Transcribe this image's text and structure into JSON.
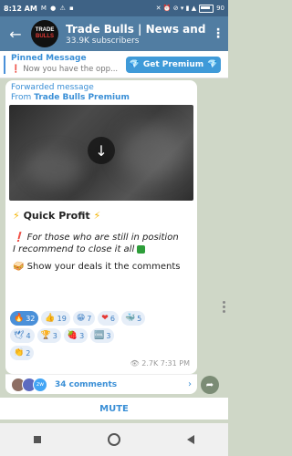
{
  "status": {
    "time": "8:12 AM",
    "left_icons": "M ● ⚠ ▪",
    "right_icons": "✕ ⏰ ⊘ ▾ ▮ ▲",
    "battery": "90"
  },
  "header": {
    "title": "Trade Bulls | News and",
    "subscribers": "33.9K subscribers",
    "avatar_line1": "TRADE",
    "avatar_line2": "BULLS"
  },
  "pinned": {
    "title": "Pinned Message",
    "text": "Now you have the opp...",
    "button": "Get Premium"
  },
  "message": {
    "forwarded": "Forwarded message",
    "from_prefix": "From",
    "from_name": "Trade Bulls Premium",
    "title": "Quick Profit",
    "line1": "For those who are still in position",
    "line2": "I recommend to close it all",
    "line3": "Show your deals it the comments",
    "views": "2.7K",
    "time": "7:31 PM"
  },
  "reactions": [
    [
      {
        "emoji": "🔥",
        "count": "32",
        "active": true
      },
      {
        "emoji": "👍",
        "count": "19"
      },
      {
        "emoji": "😁",
        "count": "7"
      },
      {
        "emoji": "❤",
        "count": "6"
      },
      {
        "emoji": "🐳",
        "count": "5"
      }
    ],
    [
      {
        "emoji": "🕊",
        "count": "4"
      },
      {
        "emoji": "🏆",
        "count": "3"
      },
      {
        "emoji": "🍓",
        "count": "3"
      },
      {
        "emoji": "🆒",
        "count": "3"
      }
    ],
    [
      {
        "emoji": "👏",
        "count": "2"
      }
    ]
  ],
  "comments": {
    "label": "34 comments",
    "avatar3": "zw"
  },
  "mute": "MUTE",
  "colors": {
    "header": "#517da2",
    "accent": "#3a8fd6",
    "chat_bg": "#cfd7c7"
  }
}
